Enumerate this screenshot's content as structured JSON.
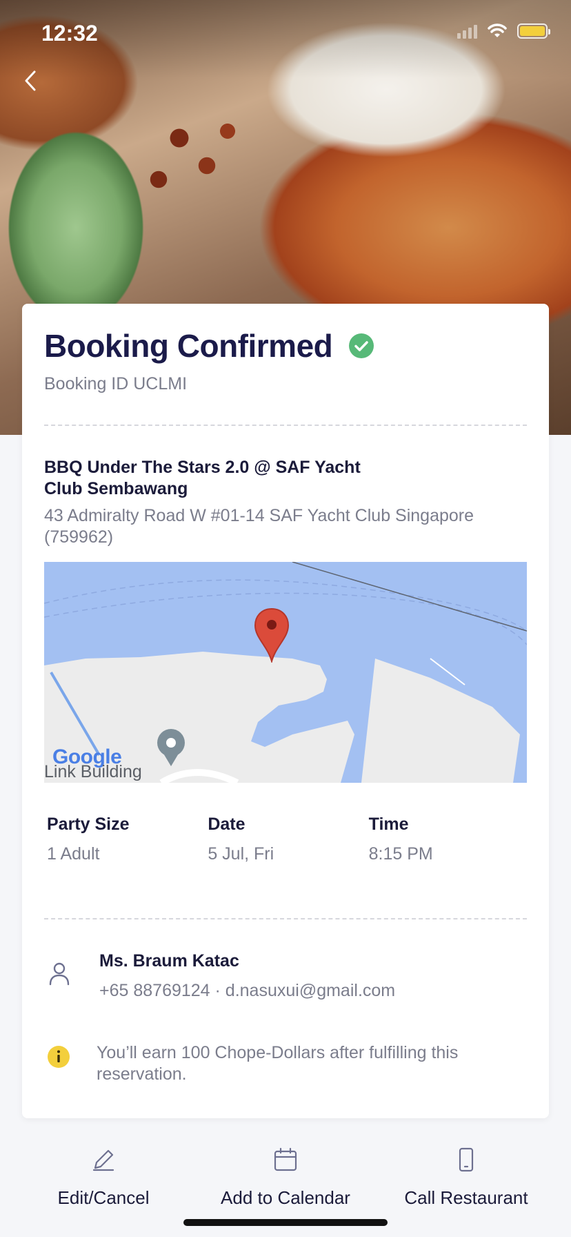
{
  "status_bar": {
    "time": "12:32"
  },
  "header": {
    "back_icon": "chevron-left-icon"
  },
  "booking": {
    "title": "Booking Confirmed",
    "status_icon": "check-circle-icon",
    "booking_id": "Booking ID UCLMI"
  },
  "restaurant": {
    "name": "BBQ Under The Stars 2.0 @ SAF Yacht Club Sembawang",
    "address": "43 Admiralty Road W #01-14 SAF Yacht Club Singapore (759962)"
  },
  "map": {
    "logo": "Google",
    "place_label": "Link Building",
    "marker_icon": "map-pin-icon"
  },
  "details": [
    {
      "label": "Party Size",
      "value": "1 Adult"
    },
    {
      "label": "Date",
      "value": "5 Jul, Fri"
    },
    {
      "label": "Time",
      "value": "8:15 PM"
    }
  ],
  "guest": {
    "icon": "person-icon",
    "name": "Ms. Braum Katac",
    "contact": "+65 88769124 · d.nasuxui@gmail.com"
  },
  "note": {
    "icon": "info-icon",
    "text": "You’ll earn 100 Chope-Dollars after fulfilling this reservation."
  },
  "actions": [
    {
      "label": "Edit/Cancel",
      "icon": "pencil-icon"
    },
    {
      "label": "Add to Calendar",
      "icon": "calendar-icon"
    },
    {
      "label": "Call Restaurant",
      "icon": "phone-icon"
    }
  ],
  "colors": {
    "title": "#1b1b4a",
    "check": "#57b978",
    "info": "#f3cf3c",
    "map_water": "#a3c0f2",
    "map_land": "#ececec",
    "marker": "#db4b3a"
  }
}
